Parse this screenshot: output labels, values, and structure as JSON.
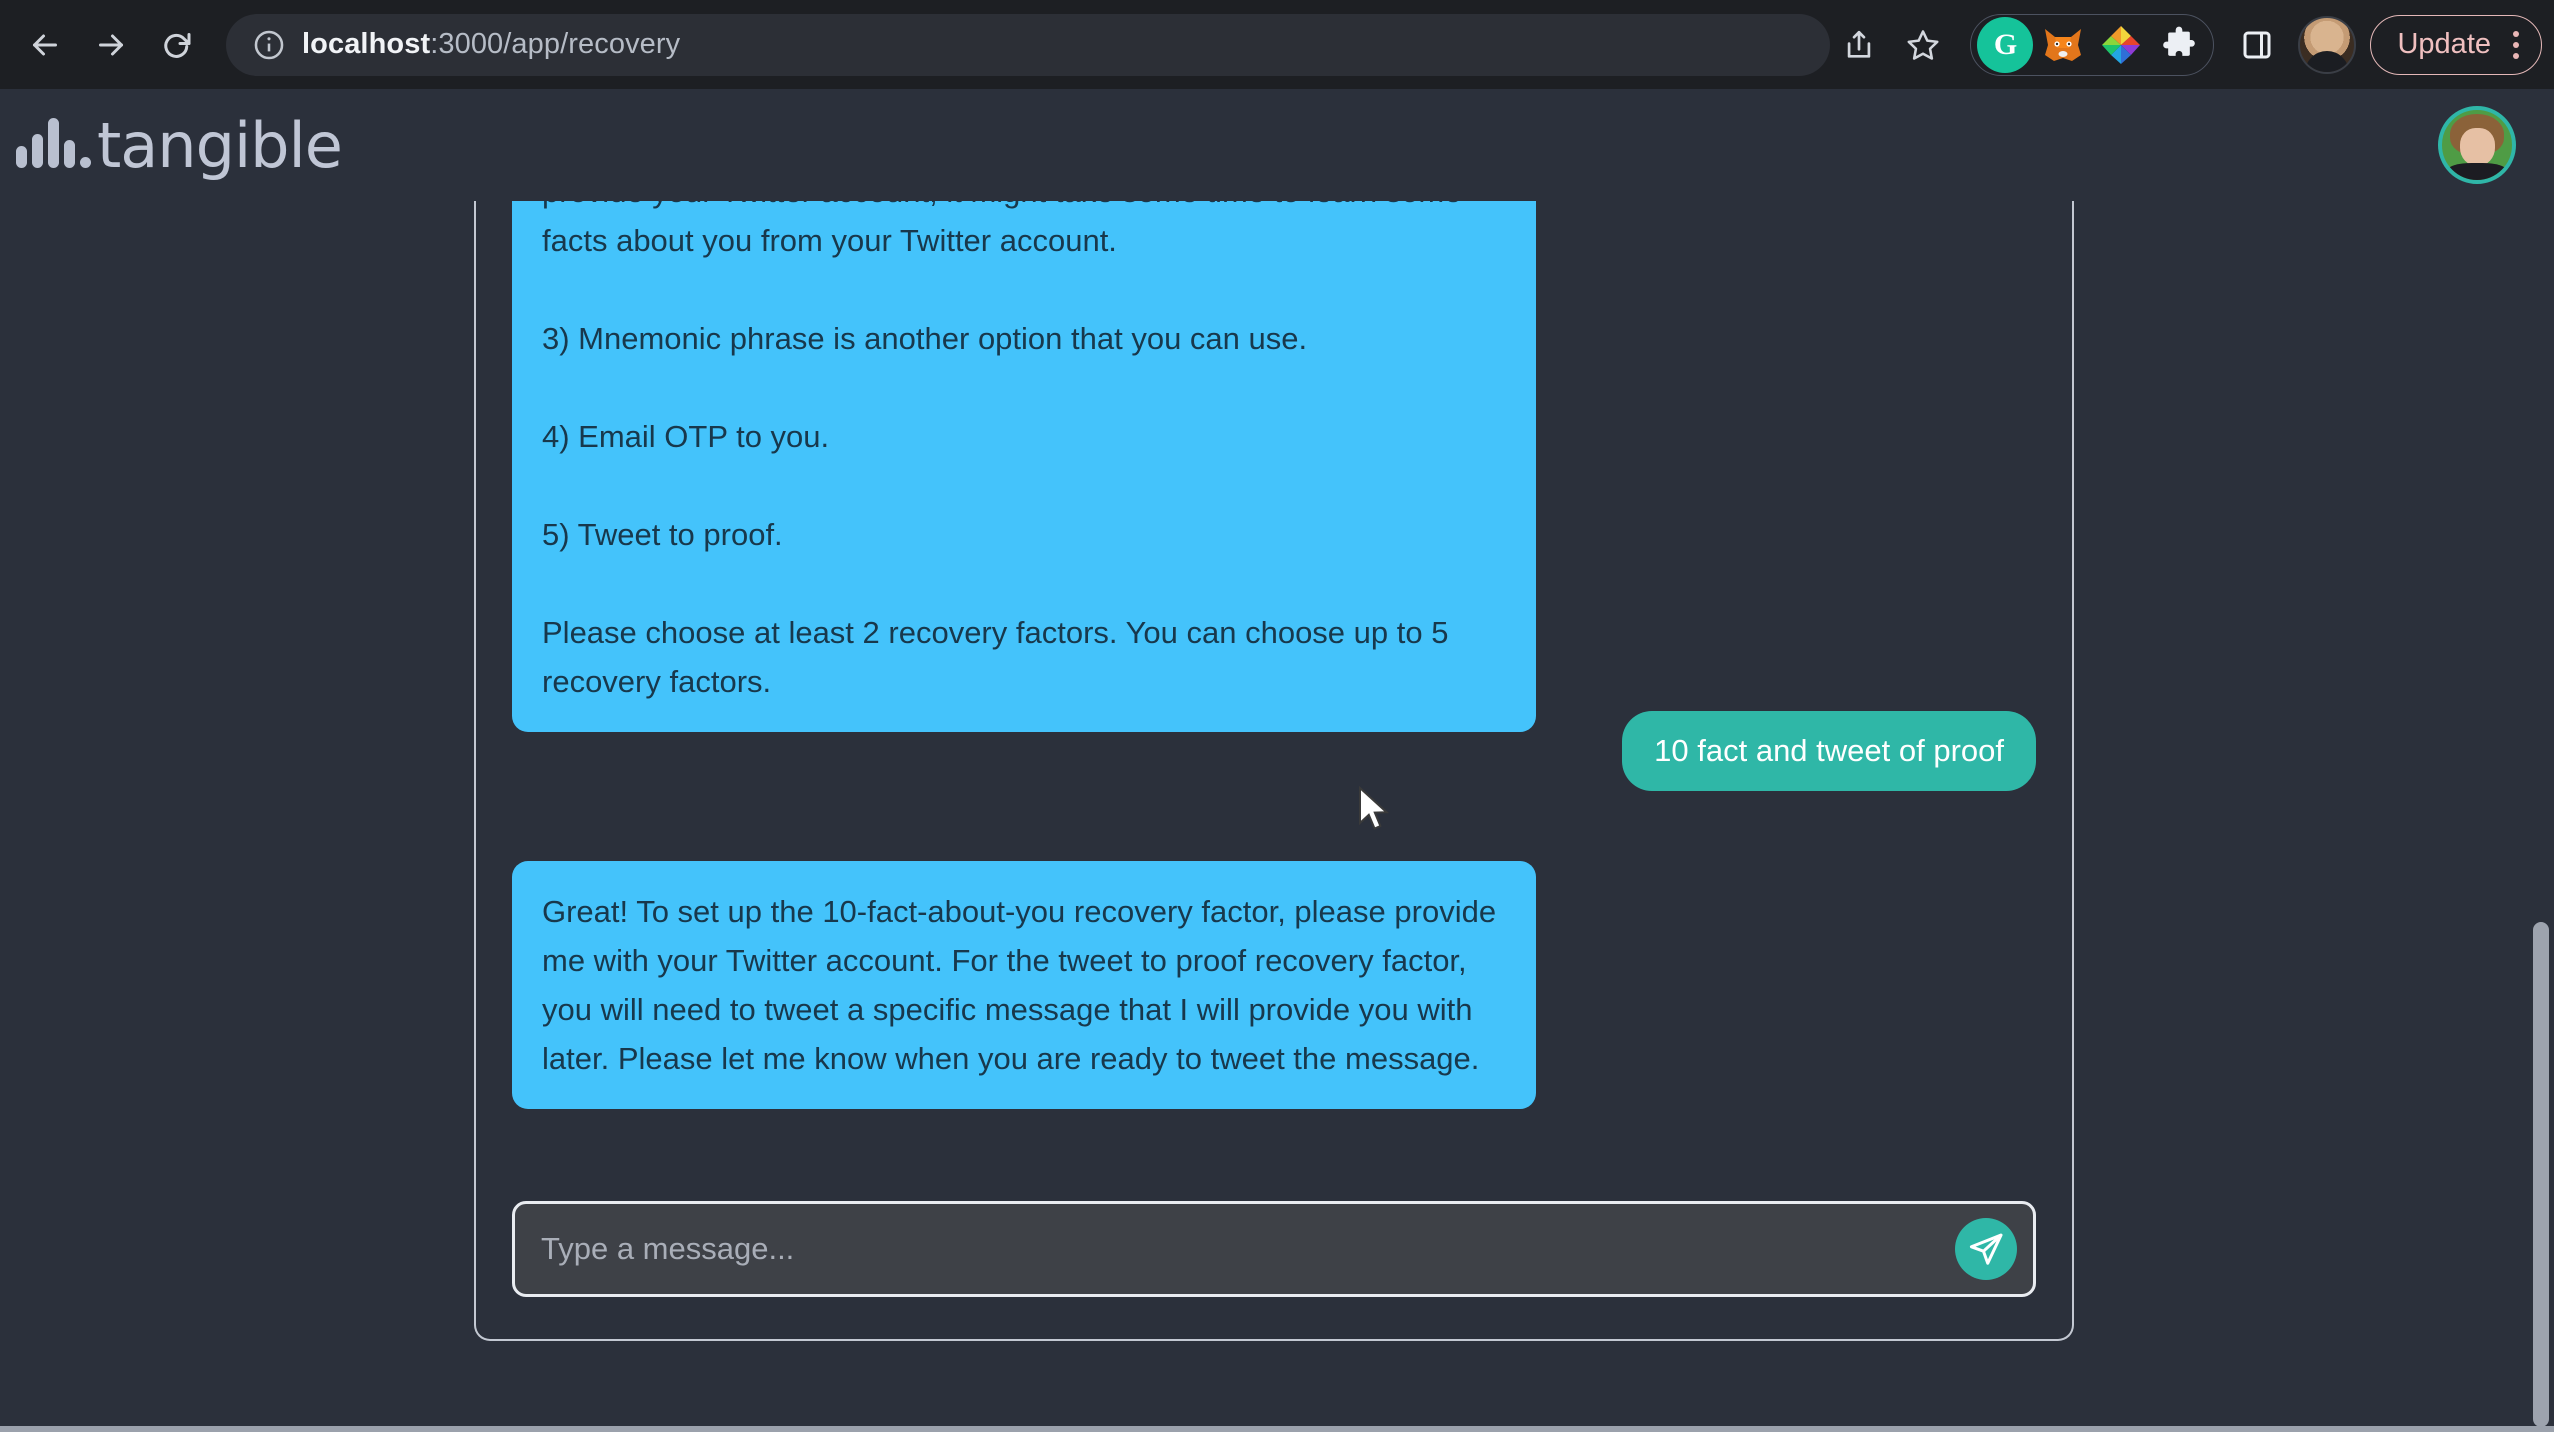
{
  "browser": {
    "back_label": "Back",
    "forward_label": "Forward",
    "reload_label": "Reload",
    "site_info_icon": "info-circle-icon",
    "url_host": "localhost",
    "url_path": ":3000/app/recovery",
    "url_full": "localhost:3000/app/recovery",
    "share_icon": "share-icon",
    "bookmark_icon": "star-icon",
    "extensions": [
      {
        "name": "grammarly-extension",
        "glyph": "G"
      },
      {
        "name": "metamask-extension",
        "glyph": "fox"
      },
      {
        "name": "color-picker-extension",
        "glyph": "color-wheel"
      },
      {
        "name": "extensions-puzzle",
        "glyph": "puzzle"
      }
    ],
    "side_panel_icon": "side-panel-icon",
    "profile_icon": "browser-profile-avatar",
    "update_label": "Update",
    "menu_icon": "kebab-menu-icon"
  },
  "app": {
    "brand": "tangible",
    "brand_mark": "waveform-bars-icon",
    "avatar_name": "user-avatar"
  },
  "chat": {
    "messages": [
      {
        "role": "bot",
        "text": "provide your Twitter account, it might take some time to learn some facts about you from your Twitter account.\n\n3) Mnemonic phrase is another option that you can use.\n\n4) Email OTP to you.\n\n5) Tweet to proof.\n\nPlease choose at least 2 recovery factors. You can choose up to 5 recovery factors.",
        "clipped_top": true
      },
      {
        "role": "user",
        "text": "10 fact and tweet of proof"
      },
      {
        "role": "bot",
        "text": "Great! To set up the 10-fact-about-you recovery factor, please provide me with your Twitter account. For the tweet to proof recovery factor, you will need to tweet a specific message that I will provide you with later. Please let me know when you are ready to tweet the message."
      }
    ],
    "composer": {
      "placeholder": "Type a message...",
      "value": "",
      "send_icon": "send-paper-plane-icon"
    }
  },
  "colors": {
    "page_bg": "#2b303b",
    "browser_bg": "#1d1f23",
    "bot_bubble": "#44c3fb",
    "bot_text": "#18384c",
    "user_bubble": "#2fb7a7",
    "accent_teal": "#2fb7a7",
    "brand_text": "#c0c6d5",
    "border_light": "#c3c8d2",
    "update_border": "#e4b8b8"
  }
}
